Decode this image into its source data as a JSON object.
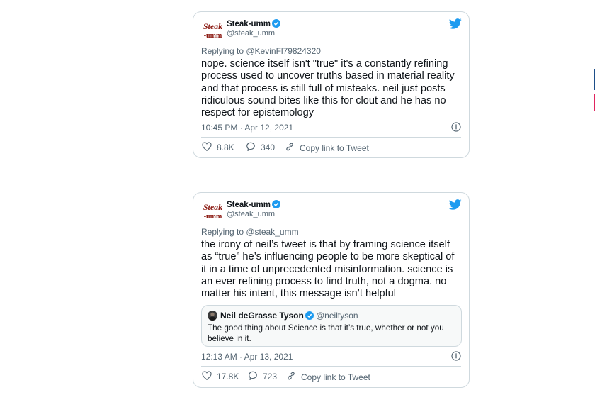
{
  "tweets": [
    {
      "author_name": "Steak-umm",
      "author_handle": "@steak_umm",
      "replying_to": "Replying to @KevinFl79824320",
      "text": "nope. science itself isn't \"true\" it's a constantly refining process used to uncover truths based in material reality and that process is still full of misteaks. neil just posts ridiculous sound bites like this for clout and he has no respect for epistemology",
      "timestamp": "10:45 PM · Apr 12, 2021",
      "likes": "8.8K",
      "replies": "340",
      "copy_link": "Copy link to Tweet"
    },
    {
      "author_name": "Steak-umm",
      "author_handle": "@steak_umm",
      "replying_to": "Replying to @steak_umm",
      "text": "the irony of neil’s tweet is that by framing science itself as “true” he’s influencing people to be more skeptical of it in a time of unprecedented misinformation. science is an ever refining process to find truth, not a dogma. no matter his intent, this message isn’t helpful",
      "quote": {
        "author_name": "Neil deGrasse Tyson",
        "author_handle": "@neiltyson",
        "text": "The good thing about Science is that it’s true, whether or not you believe in it."
      },
      "timestamp": "12:13 AM · Apr 13, 2021",
      "likes": "17.8K",
      "replies": "723",
      "copy_link": "Copy link to Tweet"
    }
  ],
  "colors": {
    "twitter_blue": "#1d9bf0",
    "text": "#0f1419",
    "muted": "#536471",
    "border": "#cfd9de",
    "brand_red": "#8b1a12"
  },
  "icons": [
    "steak-umm-logo",
    "verified-badge-icon",
    "twitter-bird-icon",
    "info-icon",
    "heart-icon",
    "reply-bubble-icon",
    "link-icon"
  ]
}
